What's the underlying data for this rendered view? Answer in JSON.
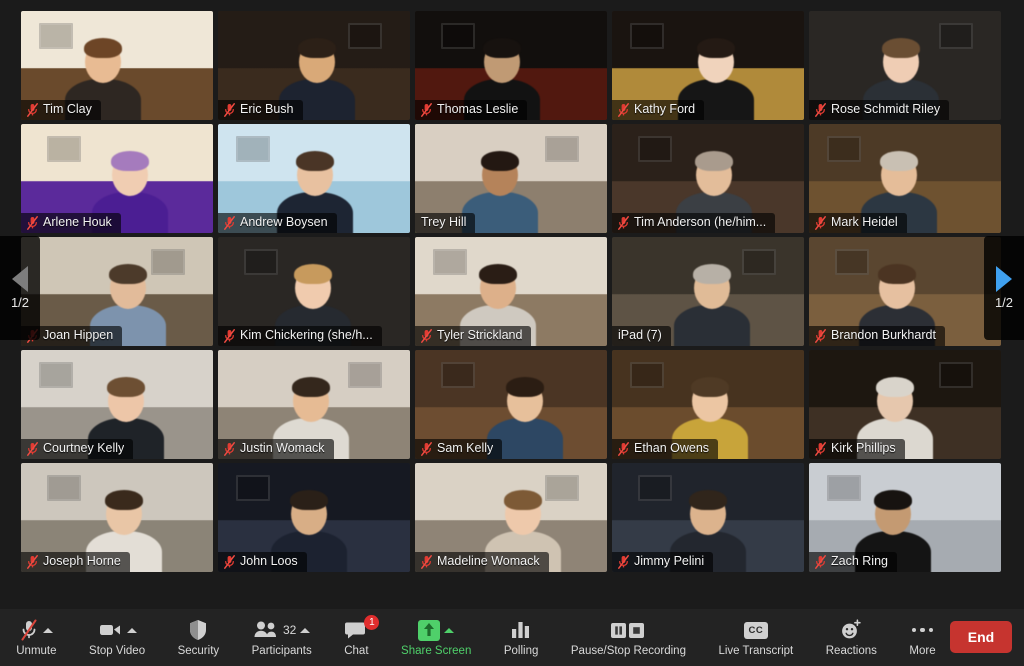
{
  "meeting": {
    "layout": "gallery-view",
    "page_indicator": "1/2",
    "active_speaker": "Trey Hill",
    "active_speaker_border_color": "#d7e84d",
    "background_color": "#1b1b1b"
  },
  "nav": {
    "prev_icon": "triangle-left-icon",
    "next_icon": "triangle-right-icon",
    "prev_enabled_color": "#7d7d7d",
    "next_enabled_color": "#3fa0ef",
    "prev_page_label": "1/2",
    "next_page_label": "1/2"
  },
  "participants": [
    {
      "name": "Tim Clay",
      "muted": true,
      "active": false,
      "wall": "#efe7d7",
      "accent": "#6a4a2c",
      "skin": "#e8bb93",
      "shirt": "#2e2722",
      "hair": "#6d4526"
    },
    {
      "name": "Eric Bush",
      "muted": true,
      "active": false,
      "wall": "#241c16",
      "accent": "#3a2b1e",
      "skin": "#d9a978",
      "shirt": "#1d2330",
      "hair": "#2c2017"
    },
    {
      "name": "Thomas Leslie",
      "muted": true,
      "active": false,
      "wall": "#120f0d",
      "accent": "#51180f",
      "skin": "#c09a74",
      "shirt": "#121212",
      "hair": "#17120f"
    },
    {
      "name": "Kathy Ford",
      "muted": true,
      "active": false,
      "wall": "#1a1410",
      "accent": "#b08a3a",
      "skin": "#f0d3bc",
      "shirt": "#161616",
      "hair": "#241a14"
    },
    {
      "name": "Rose Schmidt Riley",
      "muted": true,
      "active": false,
      "wall": "#d9d3cb",
      "accent": "#8f8madd",
      "skin": "#efcdb4",
      "shirt": "#2b3036",
      "hair": "#6a4e33"
    },
    {
      "name": "Arlene Houk",
      "muted": true,
      "active": false,
      "wall": "#efe4d0",
      "accent": "#5b2a9b",
      "skin": "#f0cdb2",
      "shirt": "#4b1e93",
      "hair": "#a57bbd"
    },
    {
      "name": "Andrew Boysen",
      "muted": true,
      "active": false,
      "wall": "#cfe4ef",
      "accent": "#9ec7db",
      "skin": "#e8c1a0",
      "shirt": "#1d2533",
      "hair": "#4a3526"
    },
    {
      "name": "Trey Hill",
      "muted": false,
      "active": true,
      "wall": "#d9cfc2",
      "accent": "#8d7f6e",
      "skin": "#b5835a",
      "shirt": "#3b5d7a",
      "hair": "#231812"
    },
    {
      "name": "Tim Anderson (he/him...",
      "muted": true,
      "active": false,
      "wall": "#2b211a",
      "accent": "#4a372a",
      "skin": "#e3bd9a",
      "shirt": "#3b3f44",
      "hair": "#a99b8d"
    },
    {
      "name": "Mark Heidel",
      "muted": true,
      "active": false,
      "wall": "#4d3a26",
      "accent": "#6e5230",
      "skin": "#e5bd99",
      "shirt": "#2c3742",
      "hair": "#c9c0b3"
    },
    {
      "name": "Joan Hippen",
      "muted": true,
      "active": false,
      "wall": "#cfc6b6",
      "accent": "#6a5b48",
      "skin": "#e2bb9a",
      "shirt": "#7d93ad",
      "hair": "#4c3a2a"
    },
    {
      "name": "Kim Chickering (she/h...",
      "muted": true,
      "active": false,
      "wall": "#e4dac9",
      "accent": "#9b8straw",
      "skin": "#f0cbae",
      "shirt": "#262a30",
      "hair": "#c79a5d"
    },
    {
      "name": "Tyler Strickland",
      "muted": true,
      "active": false,
      "wall": "#e0d8cb",
      "accent": "#8d7a63",
      "skin": "#ddb08a",
      "shirt": "#cfc9c0",
      "hair": "#2a1d15"
    },
    {
      "name": "iPad (7)",
      "muted": false,
      "active": false,
      "wall": "#3a342b",
      "accent": "#5e5345",
      "skin": "#e0bb97",
      "shirt": "#2a2f36",
      "hair": "#b7b0a6"
    },
    {
      "name": "Brandon Burkhardt",
      "muted": true,
      "active": false,
      "wall": "#5a4630",
      "accent": "#7b5f3e",
      "skin": "#e6c0a0",
      "shirt": "#2c2f35",
      "hair": "#4b3422"
    },
    {
      "name": "Courtney Kelly",
      "muted": true,
      "active": false,
      "wall": "#d7d2ca",
      "accent": "#9a948b",
      "skin": "#edc6a8",
      "shirt": "#1f2328",
      "hair": "#6d4f33"
    },
    {
      "name": "Justin Womack",
      "muted": true,
      "active": false,
      "wall": "#d6cec3",
      "accent": "#8e8476",
      "skin": "#e6bb94",
      "shirt": "#dedad2",
      "hair": "#34271c"
    },
    {
      "name": "Sam Kelly",
      "muted": true,
      "active": false,
      "wall": "#4b3524",
      "accent": "#6d4d31",
      "skin": "#e7c09b",
      "shirt": "#2d4763",
      "hair": "#2b1d13"
    },
    {
      "name": "Ethan Owens",
      "muted": true,
      "active": false,
      "wall": "#47331f",
      "accent": "#6b4c2d",
      "skin": "#ecc6a3",
      "shirt": "#c8a43a",
      "hair": "#4f3a25"
    },
    {
      "name": "Kirk Phillips",
      "muted": true,
      "active": false,
      "wall": "#1d1710",
      "accent": "#3e3024",
      "skin": "#e6c7ad",
      "shirt": "#dcd8d0",
      "hair": "#d9d4cb"
    },
    {
      "name": "Joseph Horne",
      "muted": true,
      "active": false,
      "wall": "#cdc7bd",
      "accent": "#8b8477",
      "skin": "#e9c6a6",
      "shirt": "#e3ded6",
      "hair": "#3a2a1c"
    },
    {
      "name": "John Loos",
      "muted": true,
      "active": false,
      "wall": "#161922",
      "accent": "#2a3040",
      "skin": "#d8ae86",
      "shirt": "#1c2230",
      "hair": "#2a2018"
    },
    {
      "name": "Madeline Womack",
      "muted": true,
      "active": false,
      "wall": "#dad2c5",
      "accent": "#8f8476",
      "skin": "#eec9ab",
      "shirt": "#cfc3b2",
      "hair": "#7d5a36"
    },
    {
      "name": "Jimmy Pelini",
      "muted": true,
      "active": false,
      "wall": "#20242c",
      "accent": "#343b47",
      "skin": "#dcb38d",
      "shirt": "#23272f",
      "hair": "#30251b"
    },
    {
      "name": "Zach Ring",
      "muted": true,
      "active": false,
      "wall": "#c9cdd2",
      "accent": "#a6abb1",
      "skin": "#c49a72",
      "shirt": "#141414",
      "hair": "#171310"
    }
  ],
  "toolbar": {
    "items": [
      {
        "id": "unmute",
        "label": "Unmute",
        "icon": "microphone-muted-icon",
        "chevron": true,
        "green": false
      },
      {
        "id": "stop-video",
        "label": "Stop Video",
        "icon": "video-camera-icon",
        "chevron": true,
        "green": false
      },
      {
        "id": "security",
        "label": "Security",
        "icon": "shield-icon",
        "chevron": false,
        "green": false
      },
      {
        "id": "participants",
        "label": "Participants",
        "icon": "people-icon",
        "chevron": true,
        "green": false,
        "count": "32"
      },
      {
        "id": "chat",
        "label": "Chat",
        "icon": "chat-bubble-icon",
        "chevron": false,
        "green": false,
        "badge": "1"
      },
      {
        "id": "share-screen",
        "label": "Share Screen",
        "icon": "share-screen-icon",
        "chevron": true,
        "green": true
      },
      {
        "id": "polling",
        "label": "Polling",
        "icon": "bar-chart-icon",
        "chevron": false,
        "green": false
      },
      {
        "id": "recording",
        "label": "Pause/Stop Recording",
        "icon": "pause-stop-icon",
        "chevron": false,
        "green": false
      },
      {
        "id": "transcript",
        "label": "Live Transcript",
        "icon": "closed-caption-icon",
        "chevron": false,
        "green": false,
        "cc_text": "CC"
      },
      {
        "id": "reactions",
        "label": "Reactions",
        "icon": "smiley-plus-icon",
        "chevron": false,
        "green": false
      },
      {
        "id": "more",
        "label": "More",
        "icon": "ellipsis-icon",
        "chevron": false,
        "green": false
      }
    ],
    "end_label": "End",
    "end_color": "#c6342f",
    "accent_green": "#4fd06a",
    "badge_color": "#e02d2d"
  }
}
